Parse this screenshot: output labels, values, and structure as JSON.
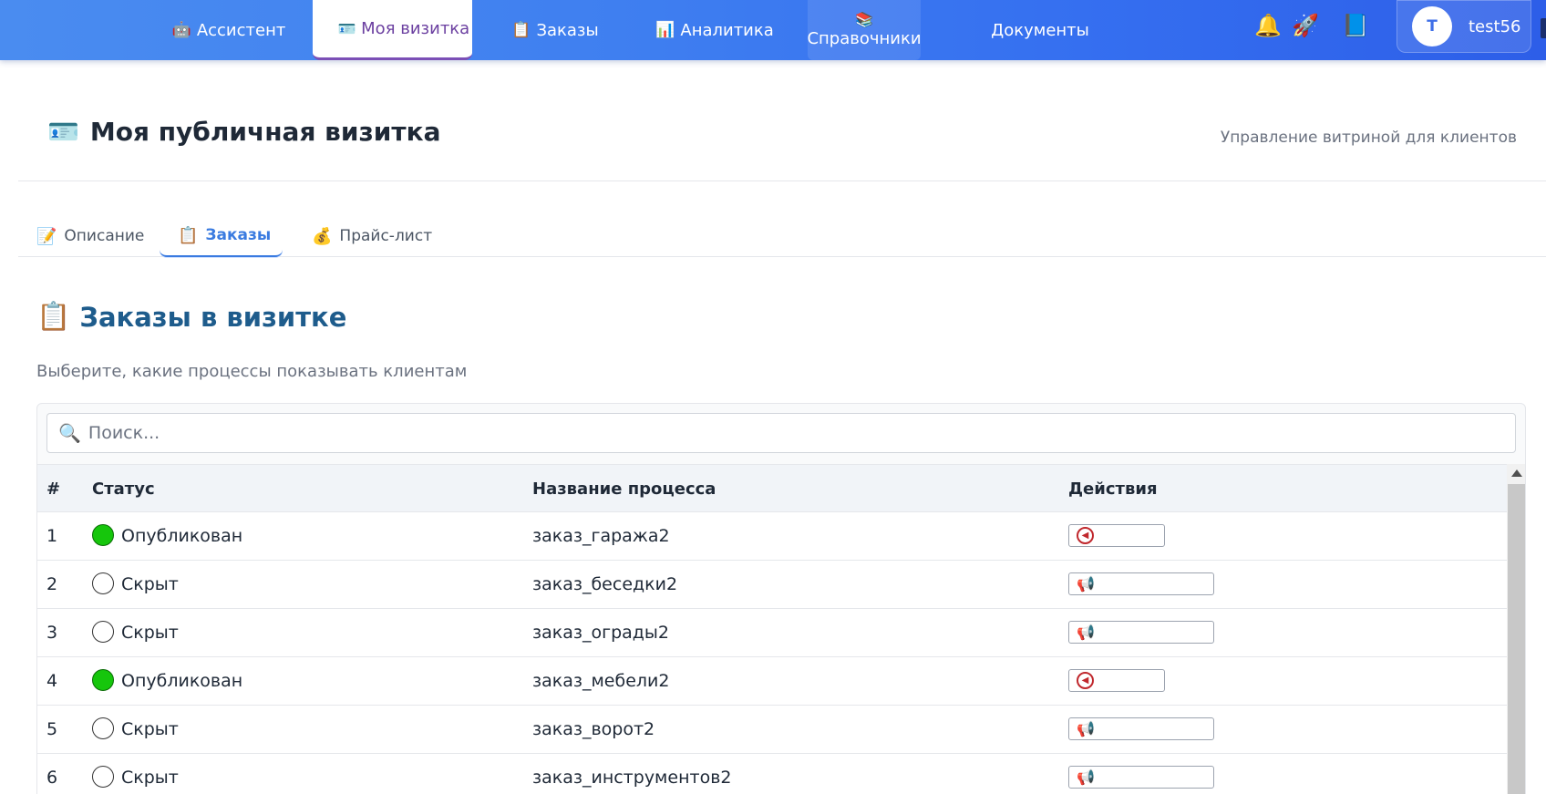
{
  "nav": {
    "items": [
      {
        "icon": "🤖",
        "label": "Ассистент"
      },
      {
        "icon": "🪪",
        "label": "Моя визитка"
      },
      {
        "icon": "📋",
        "label": "Заказы"
      },
      {
        "icon": "📊",
        "label": "Аналитика"
      },
      {
        "icon": "📚",
        "label": "Справочники"
      },
      {
        "icon": "",
        "label": "Документы"
      }
    ],
    "icons": {
      "bell": "🔔",
      "rocket": "🚀",
      "book": "📘"
    },
    "user": {
      "initial": "T",
      "name": "test56"
    }
  },
  "header": {
    "icon": "🪪",
    "title": "Моя публичная визитка",
    "subtitle": "Управление витриной для клиентов"
  },
  "tabs": [
    {
      "icon": "📝",
      "label": "Описание"
    },
    {
      "icon": "📋",
      "label": "Заказы"
    },
    {
      "icon": "💰",
      "label": "Прайс-лист"
    }
  ],
  "section": {
    "icon": "📋",
    "title": "Заказы в визитке",
    "description": "Выберите, какие процессы показывать клиентам"
  },
  "search": {
    "icon": "🔍",
    "placeholder": "Поиск..."
  },
  "table": {
    "columns": [
      "#",
      "Статус",
      "Название процесса",
      "Действия"
    ],
    "rows": [
      {
        "num": "1",
        "status": "Опубликован",
        "published": true,
        "name": "заказ_гаража2"
      },
      {
        "num": "2",
        "status": "Скрыт",
        "published": false,
        "name": "заказ_беседки2"
      },
      {
        "num": "3",
        "status": "Скрыт",
        "published": false,
        "name": "заказ_ограды2"
      },
      {
        "num": "4",
        "status": "Опубликован",
        "published": true,
        "name": "заказ_мебели2"
      },
      {
        "num": "5",
        "status": "Скрыт",
        "published": false,
        "name": "заказ_ворот2"
      },
      {
        "num": "6",
        "status": "Скрыт",
        "published": false,
        "name": "заказ_инструментов2"
      }
    ]
  },
  "colors": {
    "accent": "#3a7be0",
    "active_nav": "#6b3fa0",
    "published": "#16c60c",
    "section_title": "#1e5c8c"
  }
}
